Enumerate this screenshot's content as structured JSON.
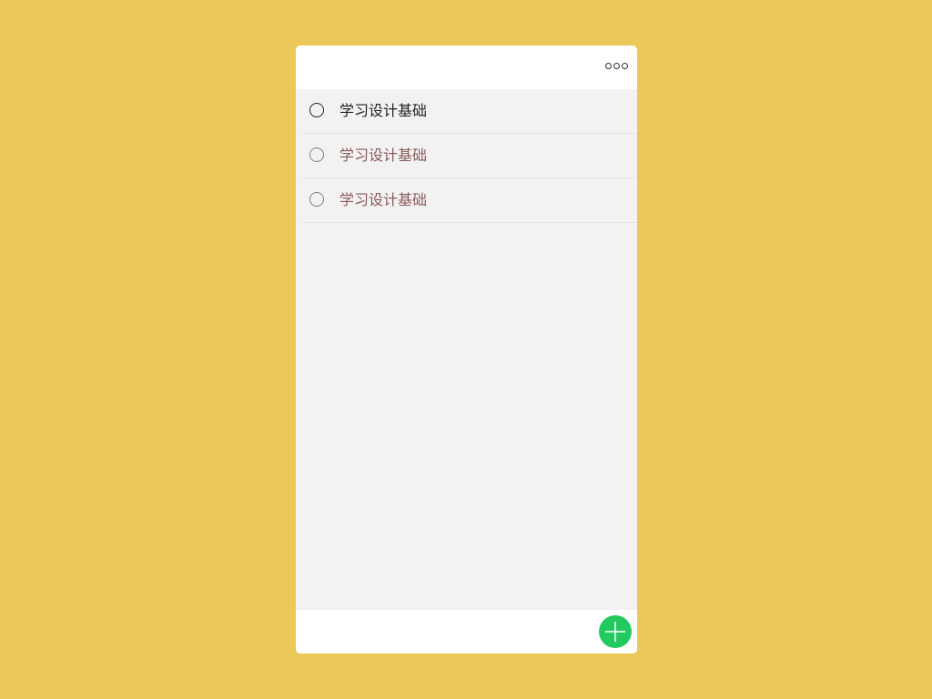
{
  "header": {
    "menu_icon": "more-dots-icon"
  },
  "tasks": [
    {
      "label": "学习设计基础",
      "done": false,
      "status_icon": "empty-circle-icon"
    },
    {
      "label": "学习设计基础",
      "done": false,
      "status_icon": "empty-circle-icon"
    },
    {
      "label": "学习设计基础",
      "done": false,
      "status_icon": "empty-circle-icon"
    }
  ],
  "footer": {
    "add_icon": "plus-icon"
  },
  "colors": {
    "background": "#ECC85A",
    "add_button": "#22C95E",
    "list_background": "#F2F2F2"
  }
}
